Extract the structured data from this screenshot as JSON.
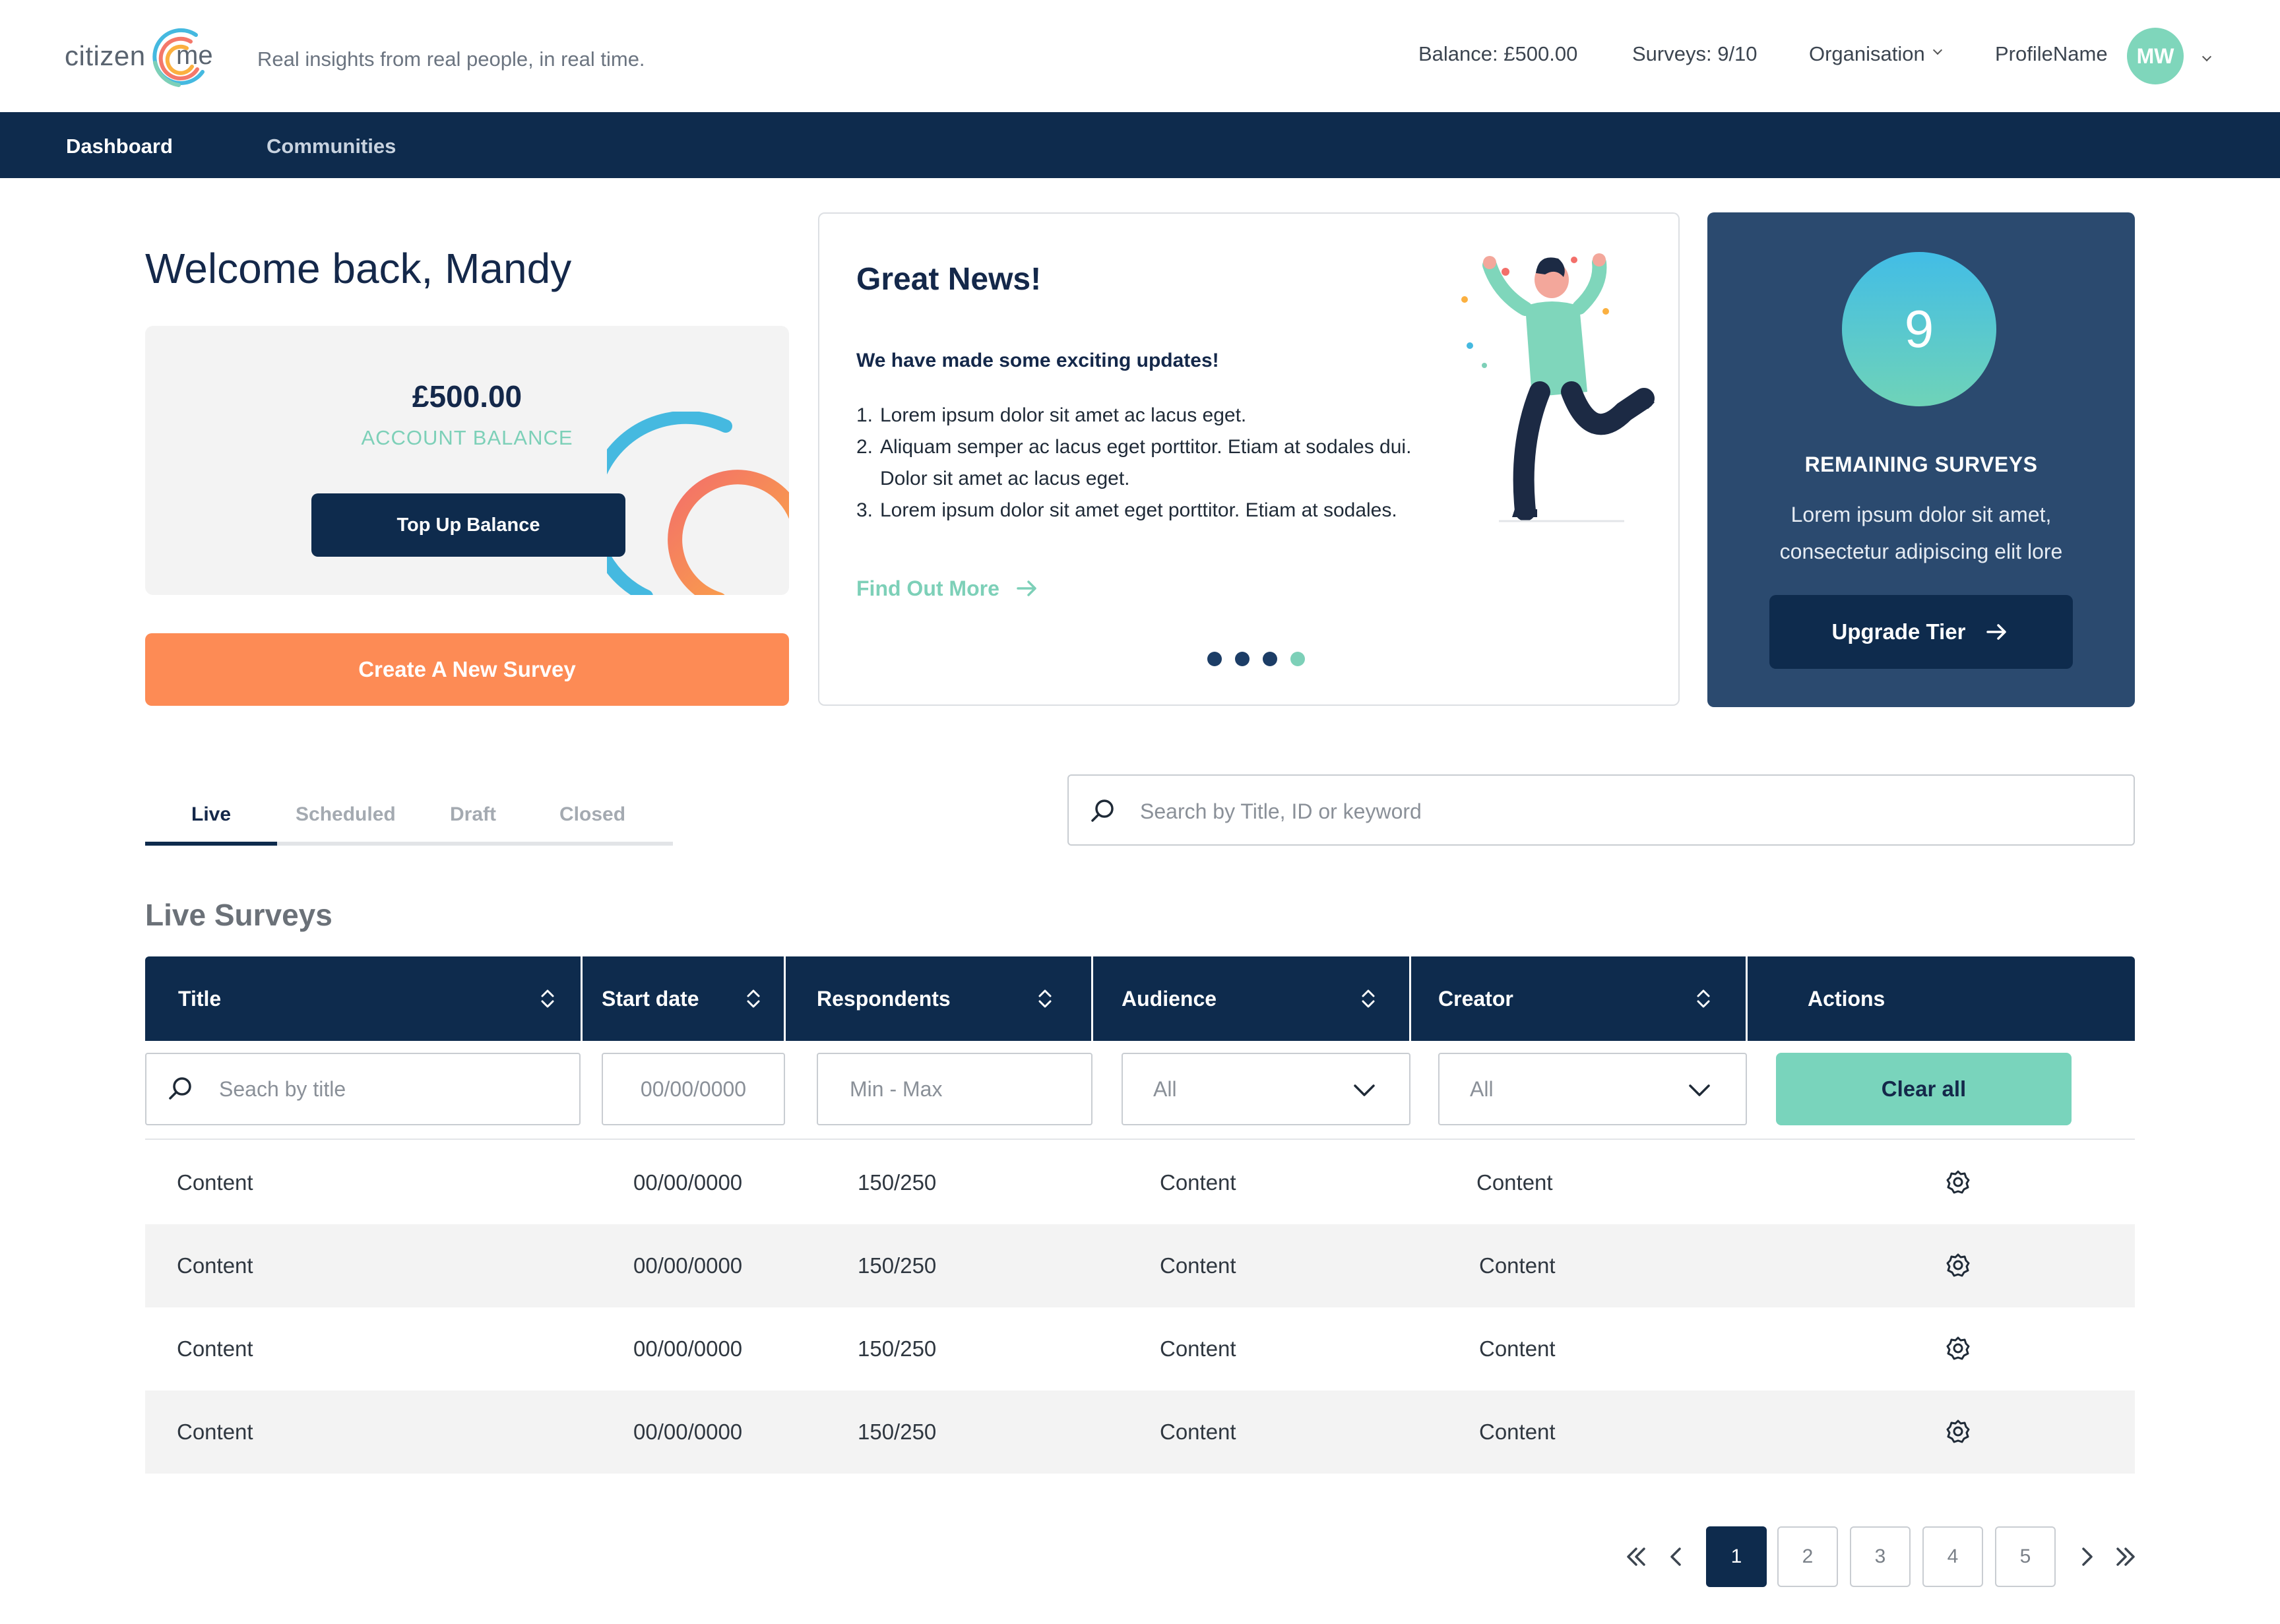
{
  "brand": {
    "logo_left": "citizen",
    "logo_right": "me",
    "tagline": "Real insights from real people, in real time."
  },
  "header": {
    "balance": "Balance: £500.00",
    "surveys": "Surveys: 9/10",
    "organisation": "Organisation",
    "profile_name": "ProfileName",
    "avatar_initials": "MW"
  },
  "nav": {
    "items": [
      {
        "label": "Dashboard",
        "active": true
      },
      {
        "label": "Communities",
        "active": false
      }
    ]
  },
  "welcome": "Welcome back, Mandy",
  "balance_card": {
    "amount": "£500.00",
    "label": "ACCOUNT BALANCE",
    "button": "Top Up Balance"
  },
  "create_button": "Create A New Survey",
  "news": {
    "title": "Great News!",
    "subtitle": "We have made some exciting updates!",
    "items": [
      {
        "num": "1.",
        "text": "Lorem ipsum dolor sit amet ac lacus eget."
      },
      {
        "num": "2.",
        "text": "Aliquam semper ac lacus eget porttitor. Etiam at sodales dui. Dolor sit amet ac lacus eget."
      },
      {
        "num": "3.",
        "text": "Lorem ipsum dolor sit amet eget porttitor. Etiam at sodales."
      }
    ],
    "link": "Find Out More",
    "carousel_active": 4,
    "carousel_count": 4
  },
  "remaining": {
    "count": "9",
    "title": "REMAINING SURVEYS",
    "description": "Lorem ipsum dolor sit amet, consectetur adipiscing elit lore",
    "button": "Upgrade Tier"
  },
  "tabs": [
    {
      "label": "Live",
      "active": true
    },
    {
      "label": "Scheduled",
      "active": false
    },
    {
      "label": "Draft",
      "active": false
    },
    {
      "label": "Closed",
      "active": false
    }
  ],
  "search": {
    "placeholder": "Search by Title, ID or keyword"
  },
  "section_title": "Live Surveys",
  "table": {
    "columns": [
      "Title",
      "Start date",
      "Respondents",
      "Audience",
      "Creator",
      "Actions"
    ],
    "filters": {
      "title_placeholder": "Seach by title",
      "date_placeholder": "00/00/0000",
      "respondents_placeholder": "Min - Max",
      "audience_value": "All",
      "creator_value": "All",
      "clear_label": "Clear all"
    },
    "rows": [
      {
        "title": "Content",
        "start_date": "00/00/0000",
        "respondents": "150/250",
        "audience": "Content",
        "creator": "Content"
      },
      {
        "title": "Content",
        "start_date": "00/00/0000",
        "respondents": "150/250",
        "audience": "Content",
        "creator": "Content"
      },
      {
        "title": "Content",
        "start_date": "00/00/0000",
        "respondents": "150/250",
        "audience": "Content",
        "creator": "Content"
      },
      {
        "title": "Content",
        "start_date": "00/00/0000",
        "respondents": "150/250",
        "audience": "Content",
        "creator": "Content"
      }
    ]
  },
  "pagination": {
    "pages": [
      "1",
      "2",
      "3",
      "4",
      "5"
    ],
    "current": "1"
  },
  "colors": {
    "navy": "#0e2b4d",
    "orange": "#fd8b55",
    "mint": "#7dd0b8",
    "card_blue": "#2b4a6f"
  }
}
